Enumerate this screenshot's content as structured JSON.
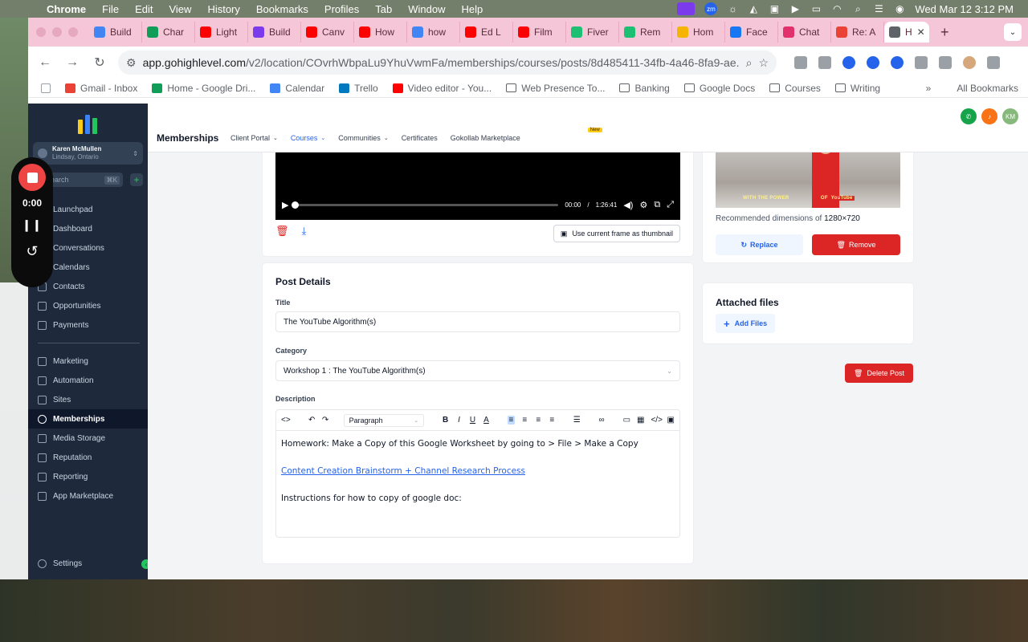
{
  "menubar": {
    "app": "Chrome",
    "menus": [
      "File",
      "Edit",
      "View",
      "History",
      "Bookmarks",
      "Profiles",
      "Tab",
      "Window",
      "Help"
    ],
    "zoom_label": "zm",
    "clock": "Wed Mar 12  3:12 PM"
  },
  "tabs": [
    {
      "label": "Build",
      "color": "#4285f4"
    },
    {
      "label": "Char",
      "color": "#0f9d58"
    },
    {
      "label": "Light",
      "color": "#ff0000"
    },
    {
      "label": "Build",
      "color": "#7c3aed"
    },
    {
      "label": "Canv",
      "color": "#ff0000"
    },
    {
      "label": "How",
      "color": "#ff0000"
    },
    {
      "label": "how",
      "color": "#4285f4"
    },
    {
      "label": "Ed L",
      "color": "#ff0000"
    },
    {
      "label": "Film",
      "color": "#ff0000"
    },
    {
      "label": "Fiver",
      "color": "#1dbf73"
    },
    {
      "label": "Rem",
      "color": "#1dbf73"
    },
    {
      "label": "Hom",
      "color": "#f4b400"
    },
    {
      "label": "Face",
      "color": "#1877f2"
    },
    {
      "label": "Chat",
      "color": "#e1306c"
    },
    {
      "label": "Re: A",
      "color": "#ea4335"
    },
    {
      "label": "H",
      "color": "#5f6368",
      "active": true
    }
  ],
  "address": {
    "domain": "app.gohighlevel.com",
    "path": "/v2/location/COvrhWbpaLu9YhuVwmFa/memberships/courses/posts/8d485411-34fb-4a46-8fa9-ae..."
  },
  "bookmarks": [
    {
      "label": "Gmail - Inbox",
      "icon": "gmail-icon"
    },
    {
      "label": "Home - Google Dri...",
      "icon": "drive-icon"
    },
    {
      "label": "Calendar",
      "icon": "calendar-icon"
    },
    {
      "label": "Trello",
      "icon": "trello-icon"
    },
    {
      "label": "Video editor - You...",
      "icon": "youtube-icon"
    },
    {
      "label": "Web Presence To...",
      "icon": "folder-icon"
    },
    {
      "label": "Banking",
      "icon": "folder-icon"
    },
    {
      "label": "Google Docs",
      "icon": "folder-icon"
    },
    {
      "label": "Courses",
      "icon": "folder-icon"
    },
    {
      "label": "Writing",
      "icon": "folder-icon"
    }
  ],
  "bookmarks_more": "»",
  "all_bookmarks": "All Bookmarks",
  "account": {
    "name": "Karen McMullen",
    "location": "Lindsay, Ontario"
  },
  "search": {
    "placeholder": "earch",
    "shortcut": "⌘K"
  },
  "recorder": {
    "time": "0:00"
  },
  "nav_primary": [
    {
      "label": "Launchpad",
      "icon": "rocket-icon"
    },
    {
      "label": "Dashboard",
      "icon": "dashboard-icon"
    },
    {
      "label": "Conversations",
      "icon": "chat-icon"
    },
    {
      "label": "Calendars",
      "icon": "calendar-icon"
    },
    {
      "label": "Contacts",
      "icon": "contacts-icon"
    },
    {
      "label": "Opportunities",
      "icon": "opportunities-icon"
    },
    {
      "label": "Payments",
      "icon": "payments-icon"
    }
  ],
  "nav_secondary": [
    {
      "label": "Marketing",
      "icon": "send-icon"
    },
    {
      "label": "Automation",
      "icon": "automation-icon"
    },
    {
      "label": "Sites",
      "icon": "sites-icon"
    },
    {
      "label": "Memberships",
      "icon": "memberships-icon",
      "active": true
    },
    {
      "label": "Media Storage",
      "icon": "media-icon"
    },
    {
      "label": "Reputation",
      "icon": "star-icon"
    },
    {
      "label": "Reporting",
      "icon": "reporting-icon"
    },
    {
      "label": "App Marketplace",
      "icon": "grid-icon"
    }
  ],
  "settings_label": "Settings",
  "topnav": {
    "title": "Memberships",
    "links": [
      {
        "label": "Client Portal",
        "dropdown": true
      },
      {
        "label": "Courses",
        "dropdown": true,
        "active": true
      },
      {
        "label": "Communities",
        "dropdown": true
      },
      {
        "label": "Certificates",
        "dropdown": false
      },
      {
        "label": "Gokollab Marketplace",
        "dropdown": false,
        "badge": "New"
      }
    ],
    "avatar_initials": "KM"
  },
  "video": {
    "current": "00:00",
    "separator": "/",
    "duration": "1:26:41",
    "progress": 0.0,
    "thumbnail_button": "Use current frame as thumbnail"
  },
  "post": {
    "heading": "Post Details",
    "title_label": "Title",
    "title_value": "The YouTube Algorithm(s)",
    "category_label": "Category",
    "category_value": "Workshop 1 : The YouTube Algorithm(s)",
    "description_label": "Description",
    "editor_block": "Paragraph",
    "body_line1": "Homework: Make a Copy of this Google Worksheet by going to > File > Make a Copy",
    "body_link": "Content Creation Brainstorm + Channel Research Process",
    "body_line3": "Instructions for how to copy of google doc:"
  },
  "thumbnail": {
    "caption_pre": "WITH THE POWER",
    "caption_of": "OF",
    "caption_brand": "YouTube",
    "dims_label": "Recommended dimensions of",
    "dims_value": "1280×720",
    "replace": "Replace",
    "remove": "Remove"
  },
  "files": {
    "heading": "Attached files",
    "add": "Add Files"
  },
  "delete_post": "Delete Post",
  "colors": {
    "accent": "#2563eb",
    "danger": "#dc2626",
    "sidebar": "#1e293b",
    "tabstrip": "#f5c6d8"
  }
}
